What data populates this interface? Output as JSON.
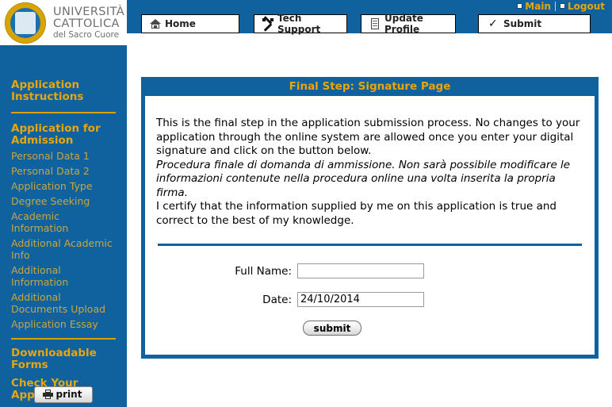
{
  "brand": {
    "line1": "UNIVERSITÀ",
    "line2": "CATTOLICA",
    "line3": "del Sacro Cuore",
    "crest_icon": "university-crest-icon"
  },
  "topbar": {
    "links": [
      {
        "label": "Main",
        "icon": "square-bullet-icon"
      },
      {
        "label": "Logout",
        "icon": "square-bullet-icon"
      }
    ]
  },
  "nav": {
    "buttons": [
      {
        "label": "Home",
        "icon": "home-icon"
      },
      {
        "label": "Tech Support",
        "icon": "tools-icon"
      },
      {
        "label": "Update Profile",
        "icon": "document-icon"
      },
      {
        "label": "Submit",
        "icon": "checkmark-icon"
      }
    ]
  },
  "sidebar": {
    "sections": [
      {
        "heading": "Application Instructions",
        "links": []
      },
      {
        "heading": "Application for Admission",
        "links": [
          "Personal Data 1",
          "Personal Data 2",
          "Application Type",
          "Degree Seeking",
          "Academic Information",
          "Additional Academic Info",
          "Additional Information",
          "Additional Documents Upload",
          "Application Essay"
        ]
      }
    ],
    "footer_headings": [
      "Downloadable Forms",
      "Check Your Application"
    ],
    "print_label": "print",
    "print_icon": "printer-icon"
  },
  "panel": {
    "title": "Final Step: Signature Page",
    "paragraphs": [
      {
        "style": "normal",
        "text": "This is the final step in the application submission process. No changes to your application through the online system are allowed once you enter your digital signature and click on the button below."
      },
      {
        "style": "italic",
        "text": "Procedura finale di domanda di ammissione. Non sarà possibile modificare le informazioni contenute nella procedura online una volta inserita la propria firma."
      },
      {
        "style": "normal",
        "text": "I certify that the information supplied by me on this application is true and correct to the best of my knowledge."
      }
    ],
    "form": {
      "fields": [
        {
          "label": "Full Name:",
          "value": "",
          "placeholder": ""
        },
        {
          "label": "Date:",
          "value": "24/10/2014",
          "placeholder": ""
        }
      ],
      "submit_label": "submit"
    }
  },
  "colors": {
    "brand_blue": "#0F629E",
    "gold": "#E8A50C",
    "muted_gold": "#C9A63F",
    "panel_bg": "#FFFFFF"
  }
}
